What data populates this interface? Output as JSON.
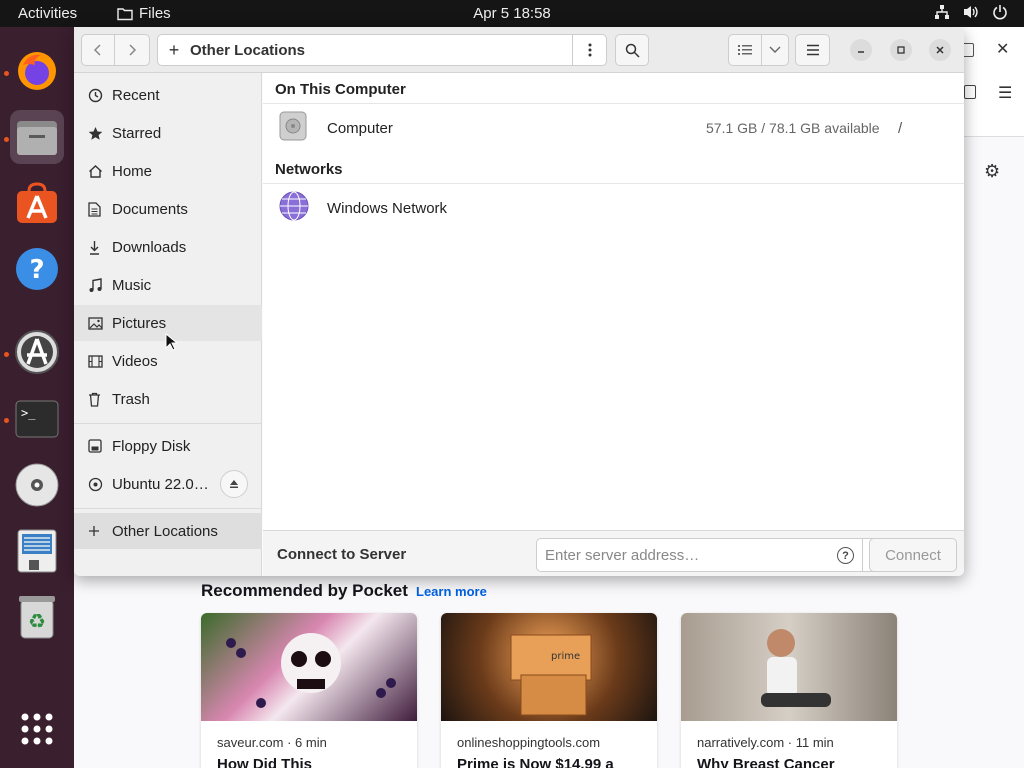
{
  "topbar": {
    "activities": "Activities",
    "app_name": "Files",
    "clock": "Apr 5  18:58"
  },
  "dock": {
    "items": [
      {
        "name": "firefox-icon"
      },
      {
        "name": "files-icon"
      },
      {
        "name": "ubuntu-software-icon"
      },
      {
        "name": "help-icon"
      },
      {
        "name": "software-updater-icon"
      },
      {
        "name": "terminal-icon"
      },
      {
        "name": "cd-drive-icon"
      },
      {
        "name": "text-editor-icon"
      },
      {
        "name": "trash-icon"
      },
      {
        "name": "show-apps-icon"
      }
    ]
  },
  "files": {
    "path": "Other Locations",
    "sidebar": {
      "items": [
        {
          "label": "Recent",
          "icon": "clock-icon"
        },
        {
          "label": "Starred",
          "icon": "star-icon"
        },
        {
          "label": "Home",
          "icon": "home-icon"
        },
        {
          "label": "Documents",
          "icon": "document-icon"
        },
        {
          "label": "Downloads",
          "icon": "download-icon"
        },
        {
          "label": "Music",
          "icon": "music-icon"
        },
        {
          "label": "Pictures",
          "icon": "picture-icon"
        },
        {
          "label": "Videos",
          "icon": "video-icon"
        },
        {
          "label": "Trash",
          "icon": "trash-icon"
        }
      ],
      "devices": [
        {
          "label": "Floppy Disk",
          "icon": "floppy-icon"
        },
        {
          "label": "Ubuntu 22.0…",
          "icon": "disc-icon"
        }
      ],
      "other": {
        "label": "Other Locations",
        "icon": "plus-icon"
      }
    },
    "sections": {
      "on_this_computer": "On This Computer",
      "networks": "Networks"
    },
    "computer": {
      "name": "Computer",
      "info": "57.1 GB / 78.1 GB available",
      "path": "/"
    },
    "network": {
      "name": "Windows Network"
    },
    "connect": {
      "label": "Connect to Server",
      "placeholder": "Enter server address…",
      "button": "Connect"
    }
  },
  "browser": {
    "pocket_title": "Recommended by Pocket",
    "learn_more": "Learn more",
    "cards": [
      {
        "source": "saveur.com · 6 min",
        "title": "How Did This",
        "color": "#7a3c5c"
      },
      {
        "source": "onlineshoppingtools.com",
        "title": "Prime is Now $14.99 a",
        "color": "#5a3a1a"
      },
      {
        "source": "narratively.com · 11 min",
        "title": "Why Breast Cancer",
        "color": "#8a7f74"
      }
    ]
  }
}
